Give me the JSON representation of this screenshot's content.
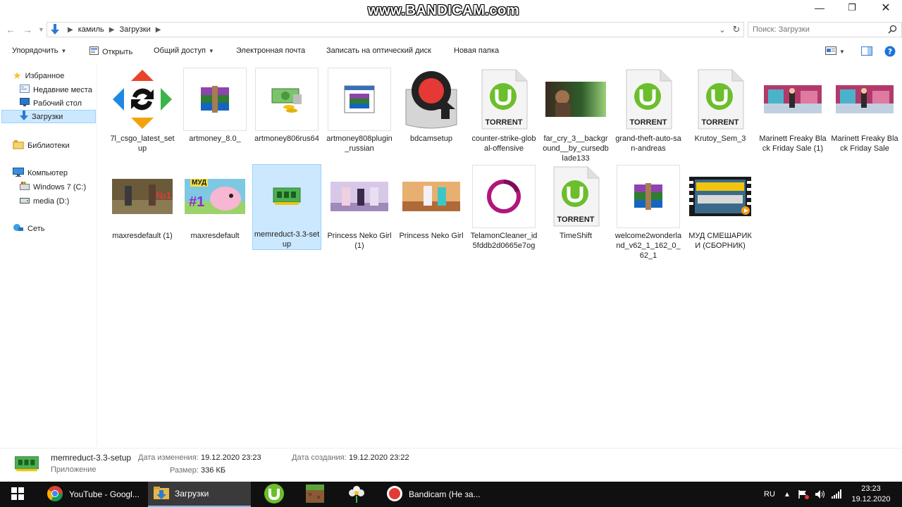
{
  "watermark": "www.BANDICAM.com",
  "address": {
    "crumbs": [
      "камиль",
      "Загрузки"
    ]
  },
  "search": {
    "placeholder": "Поиск: Загрузки"
  },
  "toolbar": {
    "organize": "Упорядочить",
    "open": "Открыть",
    "share": "Общий доступ",
    "email": "Электронная почта",
    "burn": "Записать на оптический диск",
    "new_folder": "Новая папка"
  },
  "nav": {
    "favorites": "Избранное",
    "recent": "Недавние места",
    "desktop": "Рабочий стол",
    "downloads": "Загрузки",
    "libraries": "Библиотеки",
    "computer": "Компьютер",
    "drive_c": "Windows 7 (C:)",
    "drive_d": "media (D:)",
    "network": "Сеть"
  },
  "files": [
    {
      "name": "7l_csgo_latest_setup"
    },
    {
      "name": "artmoney_8.0_"
    },
    {
      "name": "artmoney806rus64"
    },
    {
      "name": "artmoney808plugin_russian"
    },
    {
      "name": "bdcamsetup"
    },
    {
      "name": "counter-strike-global-offensive",
      "badge": "TORRENT"
    },
    {
      "name": "far_cry_3__background__by_cursedblade133"
    },
    {
      "name": "grand-theft-auto-san-andreas",
      "badge": "TORRENT"
    },
    {
      "name": "Krutoy_Sem_3",
      "badge": "TORRENT"
    },
    {
      "name": "Marinett Freaky Black Friday Sale (1)"
    },
    {
      "name": "Marinett Freaky Black Friday Sale"
    },
    {
      "name": "maxresdefault (1)",
      "overlay": "№1"
    },
    {
      "name": "maxresdefault",
      "overlay": "МУД",
      "overlay2": "#1"
    },
    {
      "name": "memreduct-3.3-setup"
    },
    {
      "name": "Princess Neko Girl (1)"
    },
    {
      "name": "Princess Neko Girl"
    },
    {
      "name": "TelamonCleaner_id5fddb2d0665e7og"
    },
    {
      "name": "TimeShift",
      "badge": "TORRENT"
    },
    {
      "name": "welcome2wonderland_v62_1_162_0_62_1"
    },
    {
      "name": "МУД СМЕШАРИКИ (СБОРНИК)"
    }
  ],
  "details": {
    "name": "memreduct-3.3-setup",
    "type": "Приложение",
    "modified_label": "Дата изменения:",
    "modified_value": "19.12.2020 23:23",
    "created_label": "Дата создания:",
    "created_value": "19.12.2020 23:22",
    "size_label": "Размер:",
    "size_value": "336 КБ"
  },
  "taskbar": {
    "chrome": "YouTube - Googl...",
    "explorer": "Загрузки",
    "bandicam": "Bandicam (Не за..."
  },
  "tray": {
    "lang": "RU",
    "time": "23:23",
    "date": "19.12.2020"
  },
  "colors": {
    "selection": "#cce8ff",
    "selection_border": "#99d1ff",
    "utorrent": "#6cbf2c",
    "taskbar": "#101010"
  }
}
